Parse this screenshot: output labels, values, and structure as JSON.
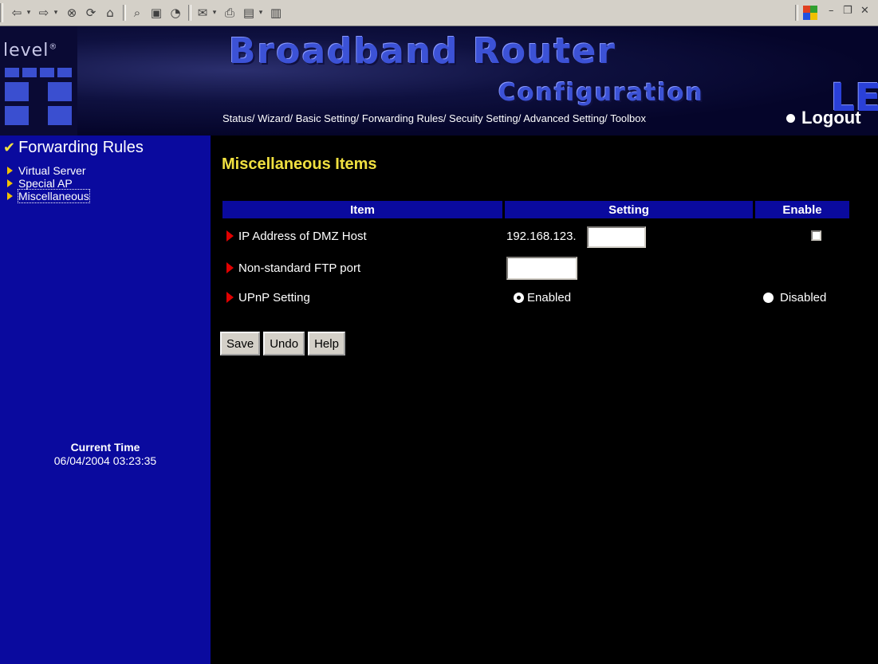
{
  "header": {
    "logo_text": "level",
    "logo_reg": "®",
    "title": "Broadband Router",
    "subtitle": "Configuration",
    "brand_partial": "LE",
    "nav": [
      "Status/",
      "Wizard/",
      "Basic Setting/",
      "Forwarding Rules/",
      "Secuity Setting/",
      "Advanced Setting/",
      "Toolbox"
    ],
    "logout": "Logout"
  },
  "sidebar": {
    "title": "Forwarding Rules",
    "items": [
      {
        "label": "Virtual Server"
      },
      {
        "label": "Special AP"
      },
      {
        "label": "Miscellaneous"
      }
    ],
    "current_time_label": "Current Time",
    "current_time": "06/04/2004 03:23:35"
  },
  "main": {
    "title": "Miscellaneous Items",
    "columns": [
      "Item",
      "Setting",
      "Enable"
    ],
    "rows": [
      {
        "label": "IP Address of DMZ Host",
        "prefix": "192.168.123.",
        "value": "",
        "enabled": false
      },
      {
        "label": "Non-standard FTP port",
        "value": ""
      },
      {
        "label": "UPnP Setting",
        "option_enabled": "Enabled",
        "option_disabled": "Disabled",
        "selected": "Enabled"
      }
    ],
    "buttons": {
      "save": "Save",
      "undo": "Undo",
      "help": "Help"
    }
  },
  "colors": {
    "sidebar_bg": "#0a0a9e",
    "title_yellow": "#f0e040",
    "header_bar": "#0a0a9e",
    "marker_red": "#e00000"
  }
}
